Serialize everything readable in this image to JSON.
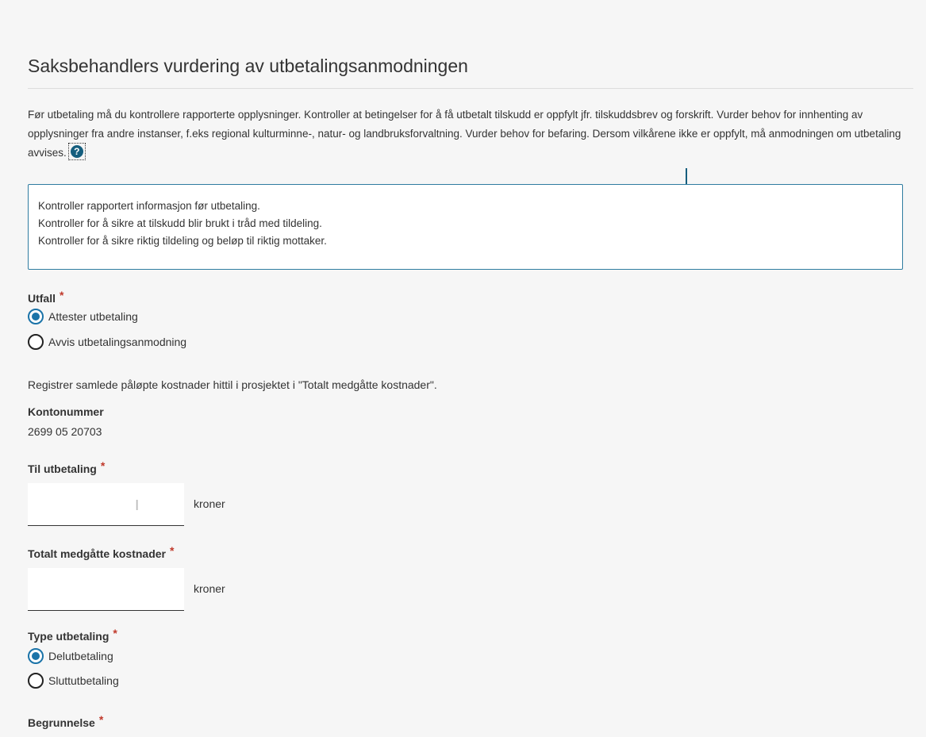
{
  "title": "Saksbehandlers vurdering av utbetalingsanmodningen",
  "intro": {
    "text": "Før utbetaling må du kontrollere rapporterte opplysninger. Kontroller at betingelser for å få utbetalt tilskudd er oppfylt jfr. tilskuddsbrev og forskrift. Vurder behov for innhenting av opplysninger fra andre instanser, f.eks regional kulturminne-, natur- og landbruksforvaltning. Vurder behov for befaring. Dersom vilkårene ikke er oppfylt, må anmodningen om utbetaling avvises.",
    "help_icon": "question-circle-icon",
    "help_glyph": "?"
  },
  "infobox": {
    "lines": [
      "Kontroller rapportert informasjon før utbetaling.",
      "Kontroller for å sikre at tilskudd blir brukt i tråd med tildeling.",
      "Kontroller for å sikre riktig tildeling og beløp til riktig mottaker."
    ]
  },
  "utfall": {
    "label": "Utfall",
    "required_mark": "*",
    "options": [
      {
        "label": "Attester utbetaling",
        "checked": true
      },
      {
        "label": "Avvis utbetalingsanmodning",
        "checked": false
      }
    ]
  },
  "register_note": "Registrer samlede påløpte kostnader hittil i prosjektet i \"Totalt medgåtte kostnader\".",
  "kontonummer": {
    "label": "Kontonummer",
    "value": "2699 05 20703"
  },
  "til_utbetaling": {
    "label": "Til utbetaling",
    "required_mark": "*",
    "value": "",
    "unit": "kroner"
  },
  "totalt": {
    "label": "Totalt medgåtte kostnader",
    "required_mark": "*",
    "value": "",
    "unit": "kroner"
  },
  "type_utbetaling": {
    "label": "Type utbetaling",
    "required_mark": "*",
    "options": [
      {
        "label": "Delutbetaling",
        "checked": true
      },
      {
        "label": "Sluttutbetaling",
        "checked": false
      }
    ]
  },
  "begrunnelse": {
    "label": "Begrunnelse",
    "required_mark": "*"
  },
  "colors": {
    "accent": "#1a73a8",
    "info_border": "#2f7ca0",
    "required": "#c0392b",
    "background": "#f6f6f6"
  }
}
